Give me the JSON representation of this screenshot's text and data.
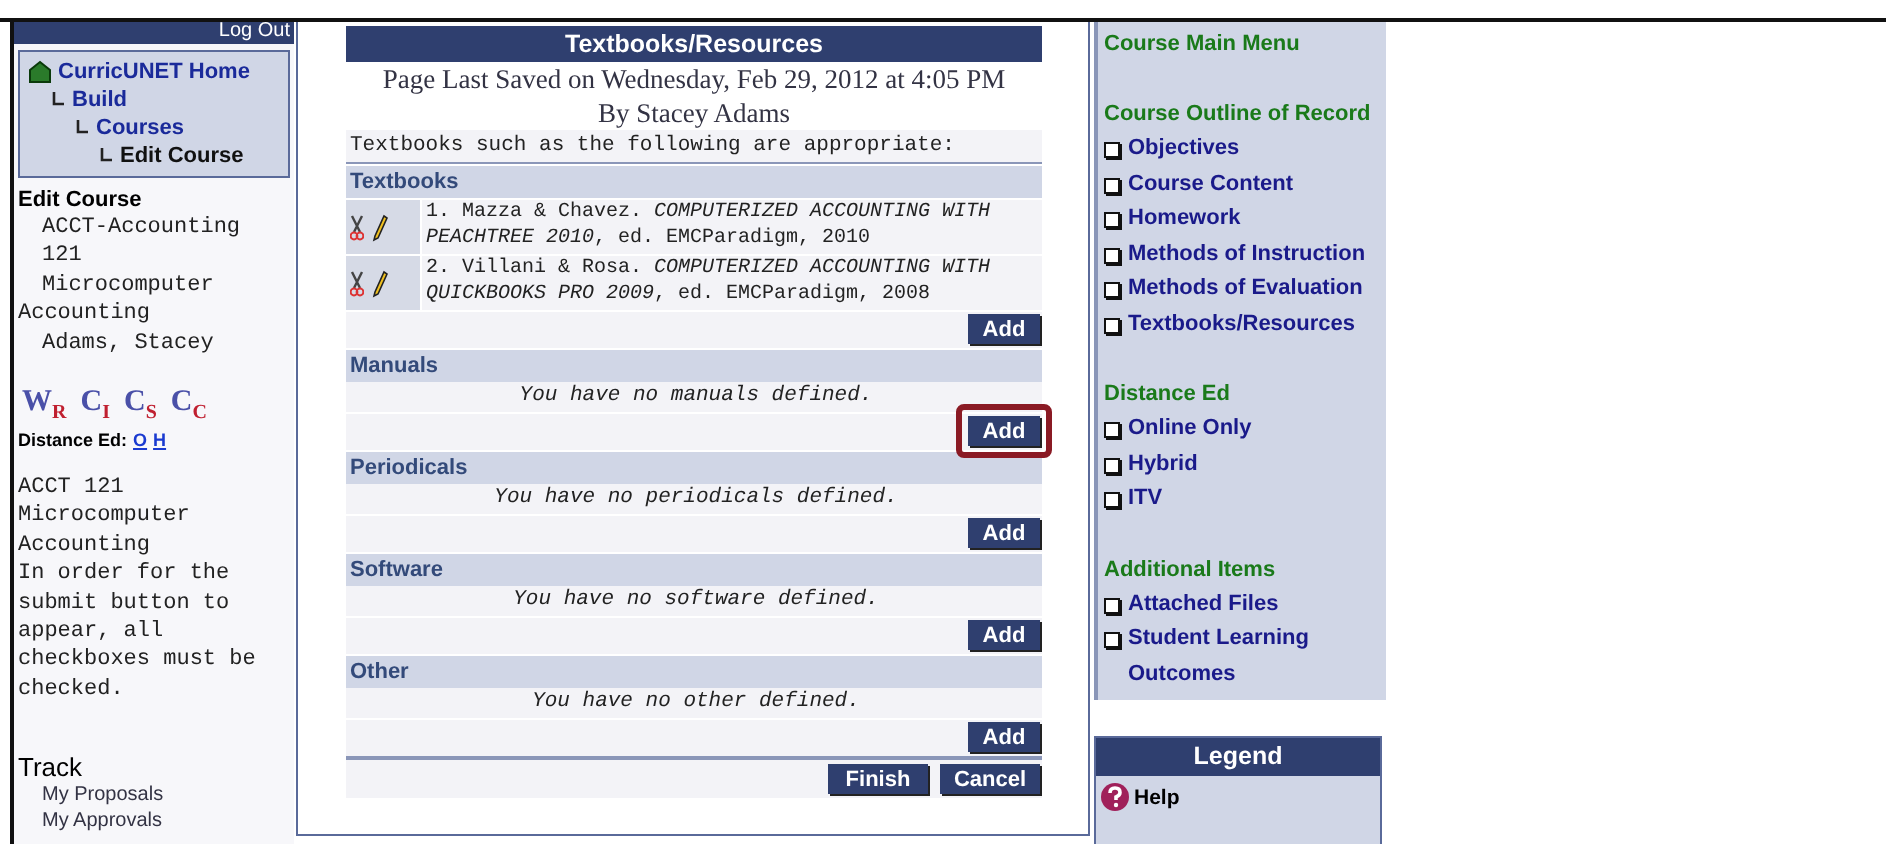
{
  "left_sidebar": {
    "logout": "Log Out",
    "breadcrumbs": [
      {
        "label": "CurricUNET Home",
        "kind": "home",
        "children": [
          {
            "label": "Build",
            "kind": "link",
            "children": [
              {
                "label": "Courses",
                "kind": "link",
                "children": [
                  {
                    "label": "Edit Course",
                    "kind": "current"
                  }
                ]
              }
            ]
          }
        ]
      }
    ],
    "edit_heading": "Edit Course",
    "course_lines": [
      "ACCT-Accounting",
      "121",
      "Microcomputer"
    ],
    "course_title_wrap": "Accounting",
    "author": "Adams, Stacey",
    "badges": [
      "W$_{R}$",
      "C$_{I}$",
      "C$_{S}$",
      "C$_{C}$"
    ],
    "distance_label": "Distance Ed:",
    "distance_links": [
      "O",
      "H"
    ],
    "note": "ACCT 121\nMicrocomputer\nAccounting\nIn order for the\nsubmit button to\nappear, all\ncheckboxes must be\nchecked.",
    "track_heading": "Track",
    "track_items": [
      "My Proposals",
      "My Approvals"
    ]
  },
  "panel": {
    "title": "Textbooks/Resources",
    "saved": "Page Last Saved on Wednesday, Feb 29, 2012 at 4:05 PM",
    "by": "By Stacey Adams",
    "intro": "Textbooks such as the following are appropriate:",
    "sections": [
      {
        "heading": "Textbooks",
        "highlighted": false,
        "items": [
          "1. Mazza & Chavez. *COMPUTERIZED ACCOUNTING WITH PEACHTREE 2010*, ed. EMCParadigm, 2010",
          "2. Villani & Rosa. *COMPUTERIZED ACCOUNTING WITH QUICKBOOKS PRO 2009*, ed. EMCParadigm, 2008"
        ],
        "add": "Add"
      },
      {
        "heading": "Manuals",
        "highlighted": true,
        "empty": "You have no manuals defined.",
        "add": "Add"
      },
      {
        "heading": "Periodicals",
        "highlighted": false,
        "empty": "You have no periodicals defined.",
        "add": "Add"
      },
      {
        "heading": "Software",
        "highlighted": false,
        "empty": "You have no software defined.",
        "add": "Add"
      },
      {
        "heading": "Other",
        "highlighted": false,
        "empty": "You have no other defined.",
        "add": "Add"
      }
    ],
    "buttons": [
      "Finish",
      "Cancel"
    ]
  },
  "right_menu": {
    "groups": [
      {
        "heading": "Course Main Menu"
      },
      {
        "heading": "Course Outline of Record",
        "items": [
          {
            "label": "Objectives",
            "checked": false
          },
          {
            "label": "Course Content",
            "checked": false
          },
          {
            "label": "Homework",
            "checked": false
          },
          {
            "label": "Methods of Instruction",
            "checked": false
          },
          {
            "label": "Methods of Evaluation",
            "checked": false
          },
          {
            "label": "Textbooks/Resources",
            "checked": false
          }
        ]
      },
      {
        "heading": "Distance Ed",
        "items": [
          {
            "label": "Online Only",
            "checked": false
          },
          {
            "label": "Hybrid",
            "checked": false
          },
          {
            "label": "ITV",
            "checked": false
          }
        ]
      },
      {
        "heading": "Additional Items",
        "items": [
          {
            "label": "Attached Files",
            "checked": false
          },
          {
            "label": "Student Learning Outcomes",
            "checked": false
          }
        ]
      }
    ],
    "legend": {
      "title": "Legend",
      "items": [
        {
          "label": "Help",
          "kind": "help"
        }
      ]
    }
  }
}
